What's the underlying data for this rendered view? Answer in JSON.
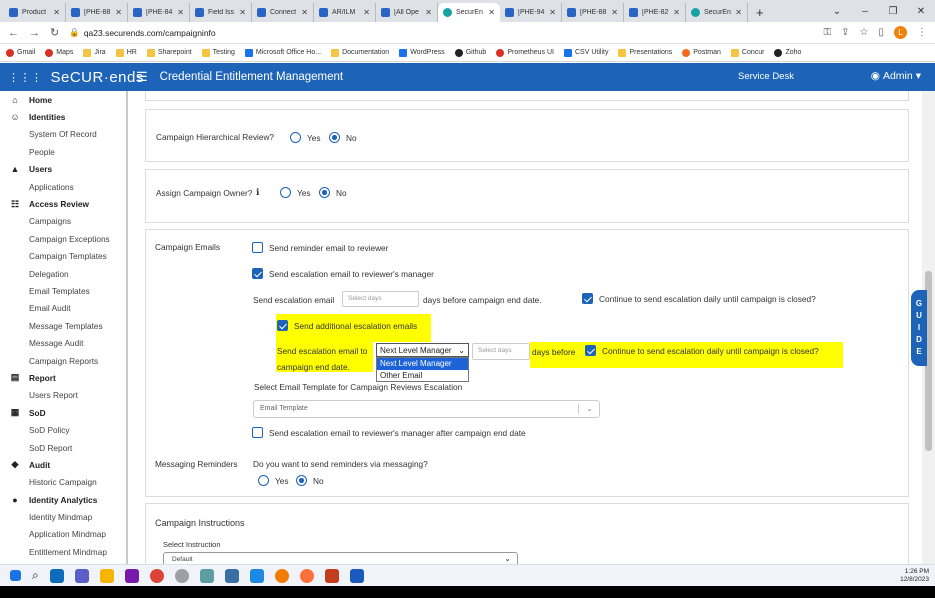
{
  "browser": {
    "tabs": [
      {
        "label": "Product",
        "active": false
      },
      {
        "label": "[PHE-88",
        "active": false
      },
      {
        "label": "[PHE-84",
        "active": false
      },
      {
        "label": "Field Iss",
        "active": false
      },
      {
        "label": "Connect",
        "active": false
      },
      {
        "label": "AR/ILM",
        "active": false
      },
      {
        "label": "[All Ope",
        "active": false
      },
      {
        "label": "SecurEn",
        "active": true
      },
      {
        "label": "[PHE-94",
        "active": false
      },
      {
        "label": "[PHE-88",
        "active": false
      },
      {
        "label": "[PHE-82",
        "active": false
      },
      {
        "label": "SecurEn",
        "active": false
      }
    ],
    "new_tab": "+",
    "url": "qa23.securends.com/campaigninfo",
    "profile_initial": "L",
    "bookmarks": [
      "Gmail",
      "Maps",
      "Jira",
      "HR",
      "Sharepoint",
      "Testing",
      "Microsoft Office Ho...",
      "Documentation",
      "WordPress",
      "Github",
      "Prometheus UI",
      "CSV Utility",
      "Presentations",
      "Postman",
      "Concur",
      "Zoho"
    ]
  },
  "header": {
    "logo": "SeCUR·ends",
    "title": "Credential Entitlement Management",
    "service_desk": "Service Desk",
    "admin": "Admin"
  },
  "sidebar": {
    "items": [
      {
        "label": "Home",
        "section": true,
        "icon": "home-icon",
        "glyph": "⌂"
      },
      {
        "label": "Identities",
        "section": true,
        "icon": "people-icon",
        "glyph": "☺"
      },
      {
        "label": "System Of Record",
        "section": false
      },
      {
        "label": "People",
        "section": false
      },
      {
        "label": "Users",
        "section": true,
        "icon": "user-icon",
        "glyph": "▲"
      },
      {
        "label": "Applications",
        "section": false
      },
      {
        "label": "Access Review",
        "section": true,
        "icon": "grid-icon",
        "glyph": "☷"
      },
      {
        "label": "Campaigns",
        "section": false
      },
      {
        "label": "Campaign Exceptions",
        "section": false
      },
      {
        "label": "Campaign Templates",
        "section": false
      },
      {
        "label": "Delegation",
        "section": false
      },
      {
        "label": "Email Templates",
        "section": false
      },
      {
        "label": "Email Audit",
        "section": false
      },
      {
        "label": "Message Templates",
        "section": false
      },
      {
        "label": "Message Audit",
        "section": false
      },
      {
        "label": "Campaign Reports",
        "section": false
      },
      {
        "label": "Report",
        "section": true,
        "icon": "report-icon",
        "glyph": "▤"
      },
      {
        "label": "Users Report",
        "section": false
      },
      {
        "label": "SoD",
        "section": true,
        "icon": "sod-icon",
        "glyph": "▦"
      },
      {
        "label": "SoD Policy",
        "section": false
      },
      {
        "label": "SoD Report",
        "section": false
      },
      {
        "label": "Audit",
        "section": true,
        "icon": "shield-icon",
        "glyph": "◆"
      },
      {
        "label": "Historic Campaign",
        "section": false
      },
      {
        "label": "Identity Analytics",
        "section": true,
        "icon": "analytics-icon",
        "glyph": "●"
      },
      {
        "label": "Identity Mindmap",
        "section": false
      },
      {
        "label": "Application Mindmap",
        "section": false
      },
      {
        "label": "Entitlement Mindmap",
        "section": false
      }
    ]
  },
  "form": {
    "hierarchical_review": {
      "label": "Campaign Hierarchical Review?",
      "yes": "Yes",
      "no": "No",
      "selected": "No"
    },
    "assign_owner": {
      "label": "Assign Campaign Owner?",
      "yes": "Yes",
      "no": "No",
      "selected": "No"
    },
    "campaign_emails": {
      "label": "Campaign Emails",
      "reminder": {
        "label": "Send reminder email to reviewer",
        "checked": false
      },
      "escalation": {
        "label": "Send escalation email to reviewer's manager",
        "checked": true
      },
      "send_escalation_prefix": "Send escalation email",
      "days_placeholder": "Select days",
      "days_suffix": "days before campaign end date.",
      "continue_daily": {
        "label": "Continue to send escalation daily until campaign is closed?",
        "checked": true
      },
      "additional": {
        "label": "Send additional escalation emails",
        "checked": true
      },
      "send_to_prefix": "Send escalation email to",
      "send_to_selected": "Next Level Manager",
      "send_to_options": [
        "Next Level Manager",
        "Other Email"
      ],
      "days_placeholder_2": "Select days",
      "days_before": "days before",
      "campaign_end_date": "campaign end date.",
      "continue_daily_2": {
        "label": "Continue to send escalation daily until campaign is closed?",
        "checked": true
      },
      "template_label": "Select Email Template for Campaign Reviews Escalation",
      "template_placeholder": "Email Template",
      "after_end": {
        "label": "Send escalation email to reviewer's manager after campaign end date",
        "checked": false
      }
    },
    "messaging": {
      "label": "Messaging Reminders",
      "question": "Do you want to send reminders via messaging?",
      "yes": "Yes",
      "no": "No",
      "selected": "No"
    },
    "instructions": {
      "title": "Campaign Instructions",
      "select_label": "Select Instruction",
      "selected": "Default"
    }
  },
  "guide": [
    "G",
    "U",
    "I",
    "D",
    "E"
  ],
  "taskbar": {
    "time": "1:26 PM",
    "date": "12/8/2023"
  },
  "colors": {
    "brand": "#1d63b8",
    "highlight": "#ffff00",
    "selected_option": "#1e63d6"
  }
}
